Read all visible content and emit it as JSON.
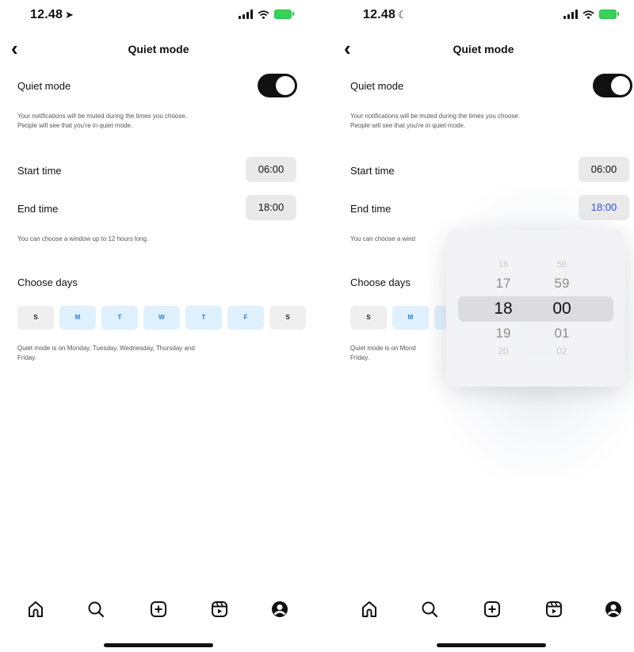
{
  "status_left": {
    "time": "12.48",
    "glyph": "➤"
  },
  "status_right": {
    "time": "12.48",
    "glyph": "☾"
  },
  "nav": {
    "title": "Quiet mode",
    "back_icon": "chevron-left-icon"
  },
  "quiet_mode": {
    "label": "Quiet mode",
    "enabled": true,
    "description_line1": "Your notifications will be muted during the times you choose.",
    "description_line2": "People will see that you're in quiet mode."
  },
  "times": {
    "start_label": "Start time",
    "start_value": "06:00",
    "end_label": "End time",
    "end_value": "18:00",
    "hint": "You can choose a window up to 12 hours long.",
    "hint_truncated": "You can choose a wind"
  },
  "days": {
    "heading": "Choose days",
    "items": [
      {
        "label": "S",
        "on": false
      },
      {
        "label": "M",
        "on": true
      },
      {
        "label": "T",
        "on": true
      },
      {
        "label": "W",
        "on": true
      },
      {
        "label": "T",
        "on": true
      },
      {
        "label": "F",
        "on": true
      },
      {
        "label": "S",
        "on": false
      }
    ],
    "summary_line1": "Quiet mode is on Monday, Tuesday, Wednesday, Thursday and",
    "summary_line2": "Friday.",
    "summary_truncated": "Quiet mode is on Mond"
  },
  "picker": {
    "hours": [
      "16",
      "17",
      "18",
      "19",
      "20"
    ],
    "minutes": [
      "58",
      "59",
      "00",
      "01",
      "02"
    ]
  },
  "tabbar": {
    "icons": [
      "home-icon",
      "search-icon",
      "create-icon",
      "reels-icon",
      "profile-icon"
    ]
  }
}
